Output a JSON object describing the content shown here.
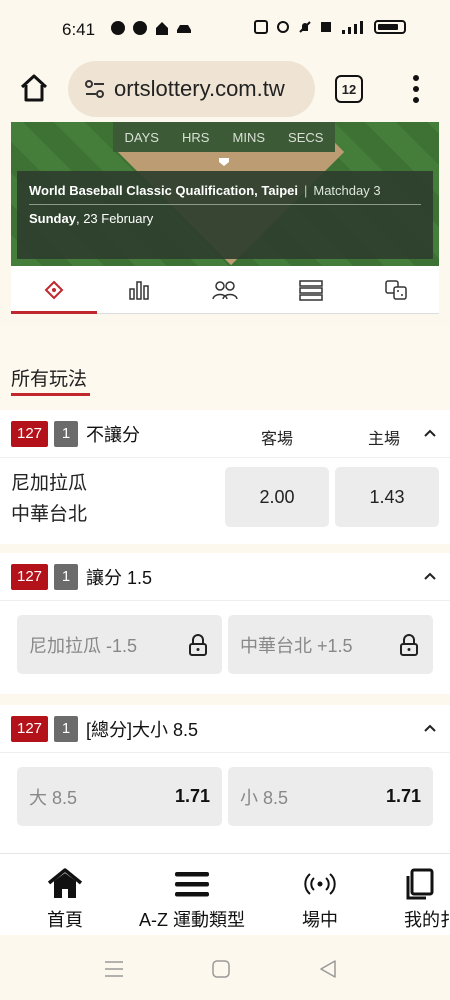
{
  "status": {
    "time": "6:41"
  },
  "browser": {
    "url": "ortslottery.com.tw",
    "tab_count": "12"
  },
  "hero": {
    "countdown_labels": [
      "DAYS",
      "HRS",
      "MINS",
      "SECS"
    ],
    "match_title": "World Baseball Classic Qualification, Taipei",
    "separator": "|",
    "matchday": "Matchday 3",
    "date_day": "Sunday",
    "date_rest": ", 23 February"
  },
  "section": {
    "title": "所有玩法"
  },
  "markets": [
    {
      "code": "127",
      "num": "1",
      "name": "不讓分",
      "col_away": "客場",
      "col_home": "主場",
      "teams": [
        "尼加拉瓜",
        "中華台北"
      ],
      "odds": [
        "2.00",
        "1.43"
      ]
    },
    {
      "code": "127",
      "num": "1",
      "name": "讓分 1.5",
      "options": [
        {
          "label": "尼加拉瓜 -1.5",
          "locked": true
        },
        {
          "label": "中華台北 +1.5",
          "locked": true
        }
      ]
    },
    {
      "code": "127",
      "num": "1",
      "name": "[總分]大小 8.5",
      "options": [
        {
          "label": "大 8.5",
          "odds": "1.71"
        },
        {
          "label": "小 8.5",
          "odds": "1.71"
        }
      ]
    }
  ],
  "bottom_nav": [
    {
      "label": "首頁",
      "icon": "home-icon"
    },
    {
      "label": "A-Z 運動類型",
      "icon": "menu-icon"
    },
    {
      "label": "場中",
      "icon": "live-icon"
    },
    {
      "label": "我的扌",
      "icon": "bets-icon"
    }
  ],
  "colors": {
    "accent": "#c0282d",
    "tag_red": "#b3121a",
    "tag_grey": "#6b6b6b"
  }
}
